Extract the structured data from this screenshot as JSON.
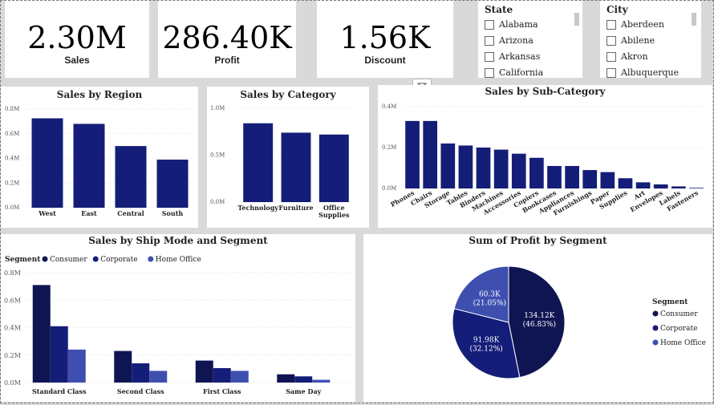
{
  "kpis": {
    "sales": {
      "value": "2.30M",
      "label": "Sales"
    },
    "profit": {
      "value": "286.40K",
      "label": "Profit"
    },
    "discount": {
      "value": "1.56K",
      "label": "Discount"
    }
  },
  "state_slicer": {
    "title": "State",
    "items": [
      "Alabama",
      "Arizona",
      "Arkansas",
      "California"
    ]
  },
  "city_slicer": {
    "title": "City",
    "items": [
      "Aberdeen",
      "Abilene",
      "Akron",
      "Albuquerque"
    ]
  },
  "colors": {
    "primary": "#141d78",
    "dark": "#0f1552",
    "light": "#3f4fb0",
    "grid": "#dddddd"
  },
  "chart_data": [
    {
      "type": "bar",
      "title": "Sales by Region",
      "categories": [
        "West",
        "East",
        "Central",
        "South"
      ],
      "values": [
        0.725,
        0.68,
        0.5,
        0.39
      ],
      "yticks": [
        "0.0M",
        "0.2M",
        "0.4M",
        "0.6M",
        "0.8M"
      ],
      "ylim": [
        0,
        0.8
      ]
    },
    {
      "type": "bar",
      "title": "Sales by Category",
      "categories": [
        "Technology",
        "Furniture",
        "Office Supplies"
      ],
      "values": [
        0.84,
        0.74,
        0.72
      ],
      "yticks": [
        "0.0M",
        "0.5M",
        "1.0M"
      ],
      "ylim": [
        0,
        1.0
      ]
    },
    {
      "type": "bar",
      "title": "Sales by Sub-Category",
      "categories": [
        "Phones",
        "Chairs",
        "Storage",
        "Tables",
        "Binders",
        "Machines",
        "Accessories",
        "Copiers",
        "Bookcases",
        "Appliances",
        "Furnishings",
        "Paper",
        "Supplies",
        "Art",
        "Envelopes",
        "Labels",
        "Fasteners"
      ],
      "values": [
        0.33,
        0.33,
        0.22,
        0.21,
        0.2,
        0.19,
        0.17,
        0.15,
        0.11,
        0.11,
        0.09,
        0.08,
        0.05,
        0.03,
        0.02,
        0.01,
        0.003
      ],
      "yticks": [
        "0.0M",
        "0.2M",
        "0.4M"
      ],
      "ylim": [
        0,
        0.4
      ]
    },
    {
      "type": "bar",
      "title": "Sales by Ship Mode and Segment",
      "legend_title": "Segment",
      "categories": [
        "Standard Class",
        "Second Class",
        "First Class",
        "Same Day"
      ],
      "series": [
        {
          "name": "Consumer",
          "values": [
            0.71,
            0.23,
            0.16,
            0.06
          ]
        },
        {
          "name": "Corporate",
          "values": [
            0.41,
            0.14,
            0.105,
            0.045
          ]
        },
        {
          "name": "Home Office",
          "values": [
            0.24,
            0.085,
            0.085,
            0.02
          ]
        }
      ],
      "yticks": [
        "0.0M",
        "0.2M",
        "0.4M",
        "0.6M",
        "0.8M"
      ],
      "ylim": [
        0,
        0.8
      ]
    },
    {
      "type": "pie",
      "title": "Sum of Profit by Segment",
      "legend_title": "Segment",
      "slices": [
        {
          "name": "Consumer",
          "value": 134.12,
          "label": "134.12K",
          "pct": "(46.83%)"
        },
        {
          "name": "Corporate",
          "value": 91.98,
          "label": "91.98K",
          "pct": "(32.12%)"
        },
        {
          "name": "Home Office",
          "value": 60.3,
          "label": "60.3K",
          "pct": "(21.05%)"
        }
      ]
    }
  ]
}
